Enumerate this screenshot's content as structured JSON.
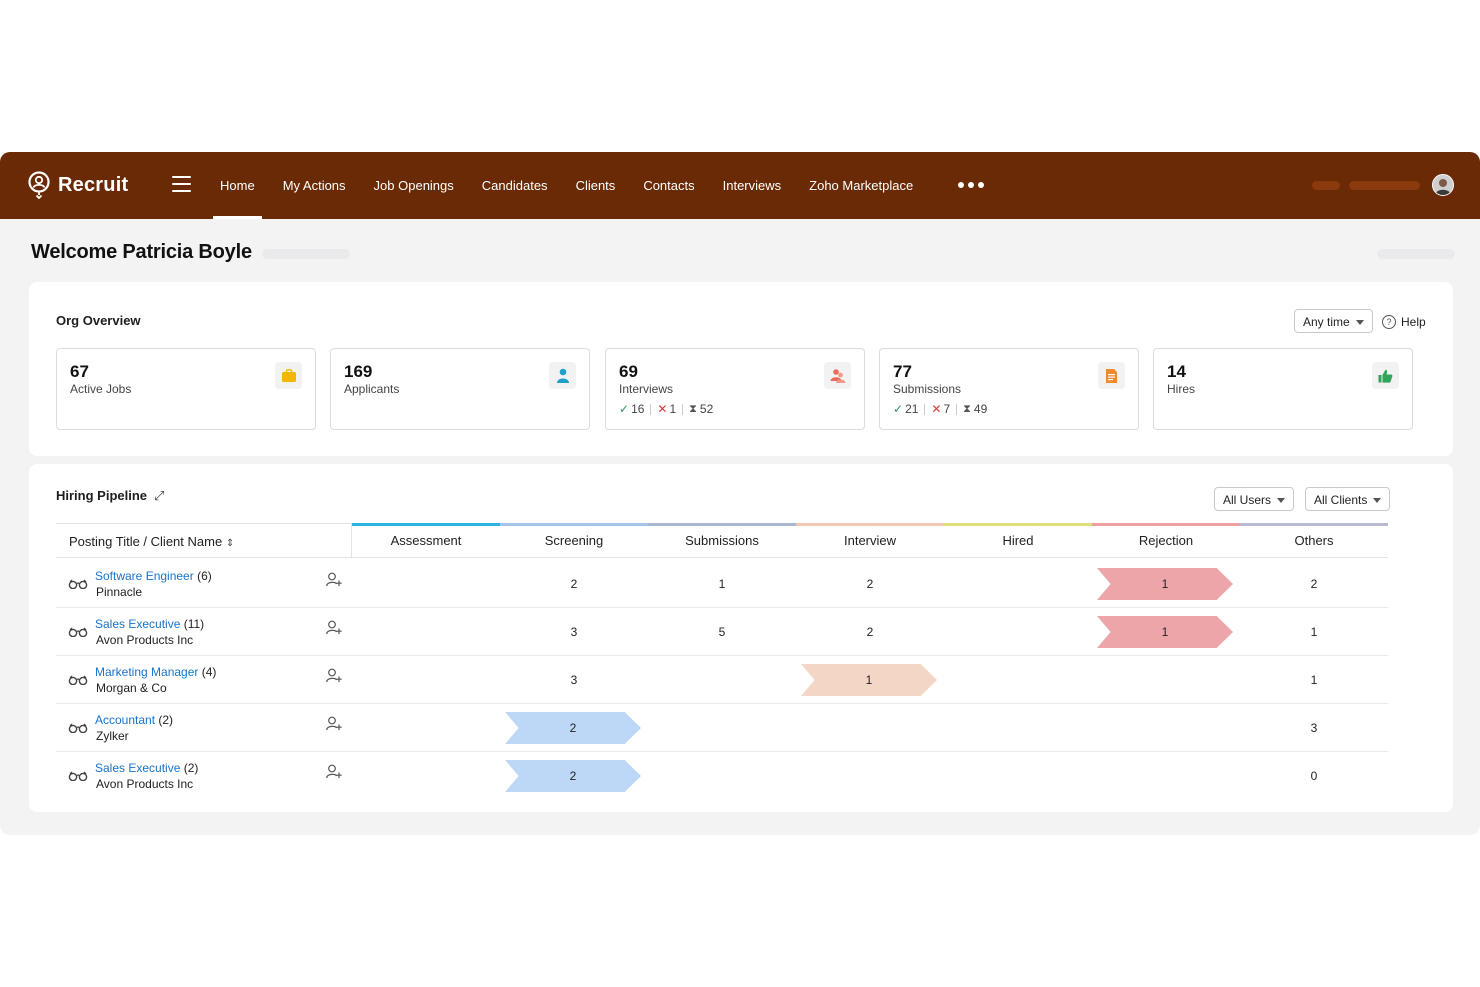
{
  "app": {
    "name": "Recruit"
  },
  "nav": {
    "items": [
      "Home",
      "My Actions",
      "Job Openings",
      "Candidates",
      "Clients",
      "Contacts",
      "Interviews",
      "Zoho Marketplace"
    ],
    "active": "Home"
  },
  "welcome": "Welcome Patricia Boyle",
  "org": {
    "title": "Org Overview",
    "time_filter": "Any time",
    "help": "Help",
    "stats": [
      {
        "value": "67",
        "label": "Active Jobs",
        "icon": "briefcase-icon",
        "color": "#f2b705"
      },
      {
        "value": "169",
        "label": "Applicants",
        "icon": "user-icon",
        "color": "#1fa0c9"
      },
      {
        "value": "69",
        "label": "Interviews",
        "icon": "users-icon",
        "color": "#e96a5a",
        "passed": "16",
        "rejected": "1",
        "pending": "52"
      },
      {
        "value": "77",
        "label": "Submissions",
        "icon": "document-icon",
        "color": "#f08a2c",
        "passed": "21",
        "rejected": "7",
        "pending": "49"
      },
      {
        "value": "14",
        "label": "Hires",
        "icon": "thumbs-up-icon",
        "color": "#2fa45a"
      }
    ]
  },
  "pipeline": {
    "title": "Hiring Pipeline",
    "filters": {
      "users": "All Users",
      "clients": "All Clients"
    },
    "posting_header": "Posting Title / Client Name",
    "stages": [
      {
        "name": "Assessment",
        "color": "#2bb5de"
      },
      {
        "name": "Screening",
        "color": "#a6c4ea"
      },
      {
        "name": "Submissions",
        "color": "#a9b7d0"
      },
      {
        "name": "Interview",
        "color": "#f0c9b4"
      },
      {
        "name": "Hired",
        "color": "#dfe07a"
      },
      {
        "name": "Rejection",
        "color": "#ee9fa3"
      },
      {
        "name": "Others",
        "color": "#b8bbcf"
      }
    ],
    "rows": [
      {
        "title": "Software Engineer",
        "count": "(6)",
        "client": "Pinnacle",
        "values": [
          "",
          "2",
          "1",
          "2",
          "",
          "1",
          "2"
        ],
        "highlight": 5
      },
      {
        "title": "Sales Executive",
        "count": "(11)",
        "client": "Avon Products Inc",
        "values": [
          "",
          "3",
          "5",
          "2",
          "",
          "1",
          "1"
        ],
        "highlight": 5
      },
      {
        "title": "Marketing Manager",
        "count": "(4)",
        "client": "Morgan & Co",
        "values": [
          "",
          "3",
          "",
          "1",
          "",
          "",
          "1"
        ],
        "highlight": 3
      },
      {
        "title": "Accountant",
        "count": "(2)",
        "client": "Zylker",
        "values": [
          "",
          "2",
          "",
          "",
          "",
          "",
          "3"
        ],
        "highlight": 1
      },
      {
        "title": "Sales Executive",
        "count": "(2)",
        "client": "Avon Products Inc",
        "values": [
          "",
          "2",
          "",
          "",
          "",
          "",
          "0"
        ],
        "highlight": 1
      }
    ],
    "highlight_colors": {
      "1": "#bdd8f6",
      "3": "#f3d6c5",
      "5": "#eea5a9"
    }
  }
}
